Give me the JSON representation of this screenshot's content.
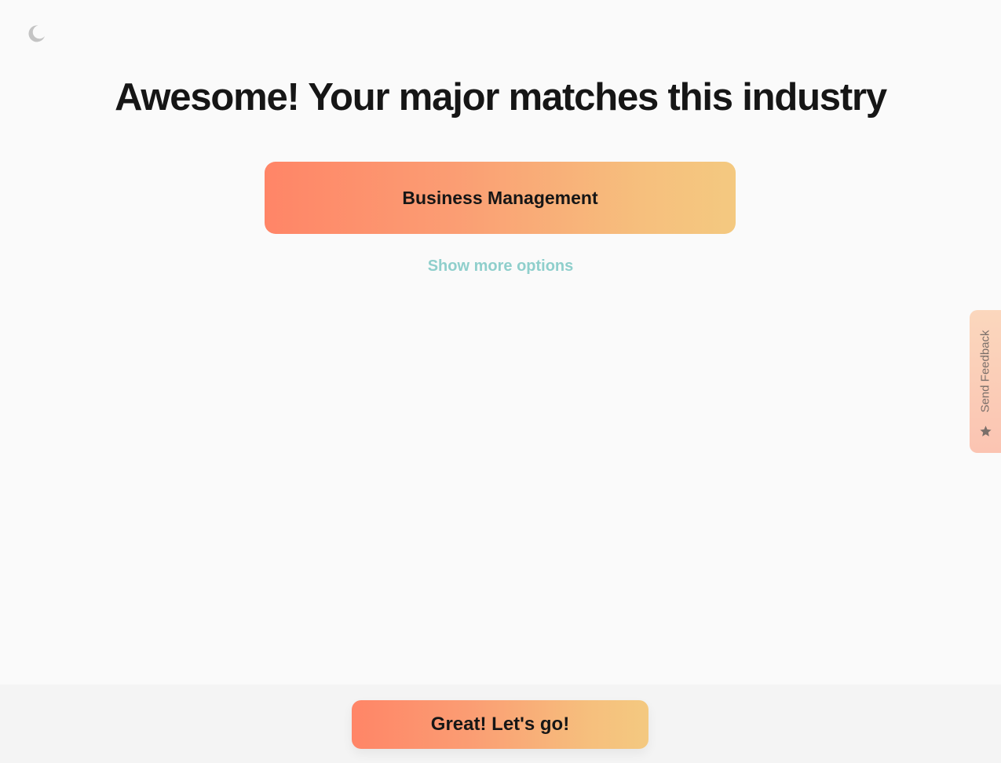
{
  "theme_toggle": {
    "icon": "moon-icon",
    "color": "#c4c4c4"
  },
  "headline": "Awesome! Your major matches this industry",
  "industry_options": [
    {
      "label": "Business Management"
    }
  ],
  "show_more_label": "Show more options",
  "feedback": {
    "label": "Send Feedback",
    "icon": "star-icon"
  },
  "cta": {
    "label": "Great! Let's go!"
  },
  "colors": {
    "background": "#fafafa",
    "gradient_start": "#ff8567",
    "gradient_end": "#f4c980",
    "link": "#8fcfcc",
    "text": "#161616"
  }
}
